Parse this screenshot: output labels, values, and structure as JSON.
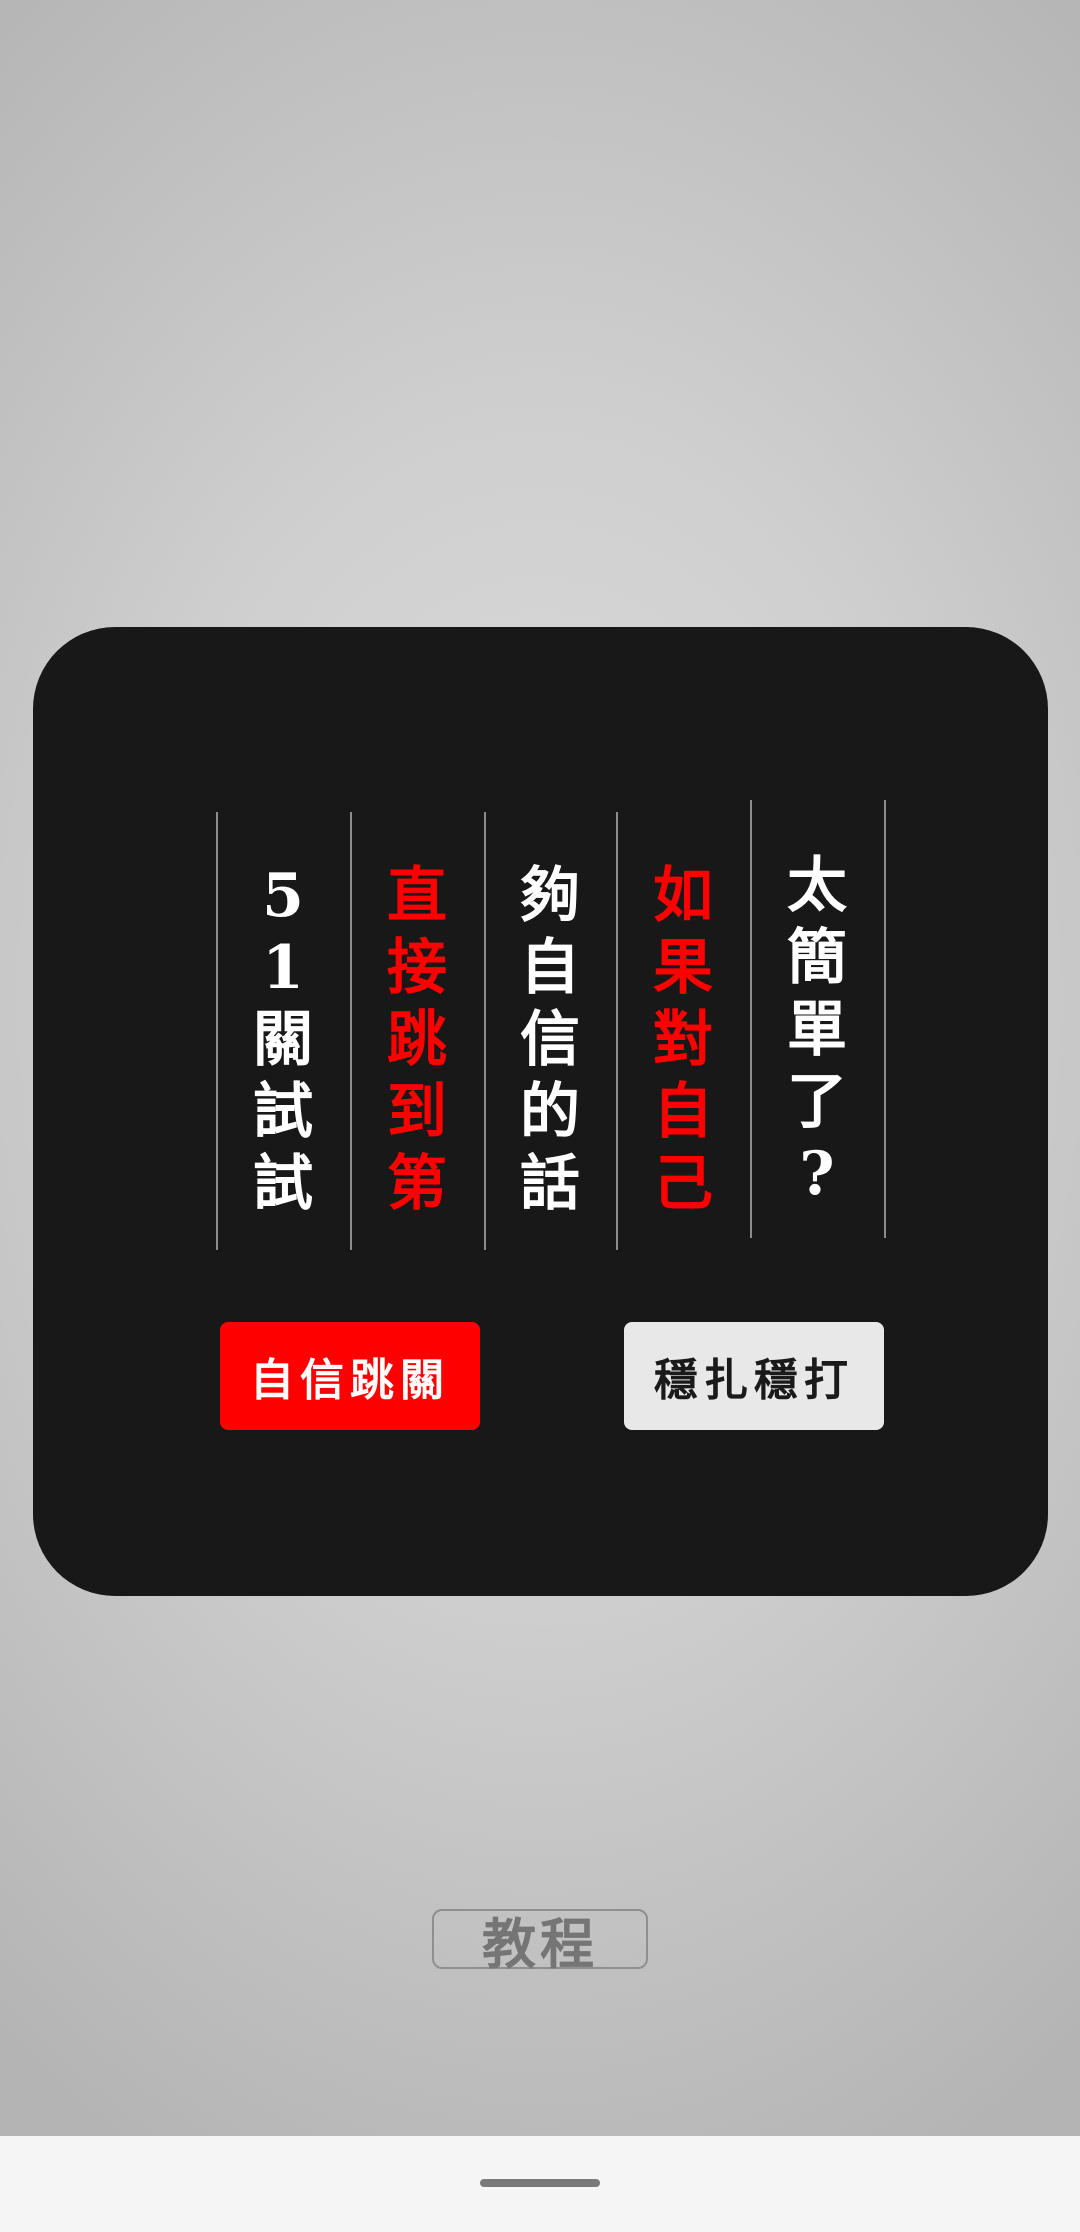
{
  "dialog": {
    "columns": [
      {
        "text": "太簡單了?",
        "color": "#ffffff"
      },
      {
        "text": "如果對自己",
        "color": "#ff0000"
      },
      {
        "text": "夠自信的話",
        "color": "#ffffff"
      },
      {
        "text": "直接跳到第",
        "color": "#ff0000"
      },
      {
        "text": "51關試試",
        "color": "#ffffff"
      }
    ],
    "confident_button_label": "自信跳關",
    "steady_button_label": "穩扎穩打"
  },
  "tutorial_button_label": "教程",
  "colors": {
    "accent_red": "#ff0000",
    "dialog_background": "#181818"
  }
}
